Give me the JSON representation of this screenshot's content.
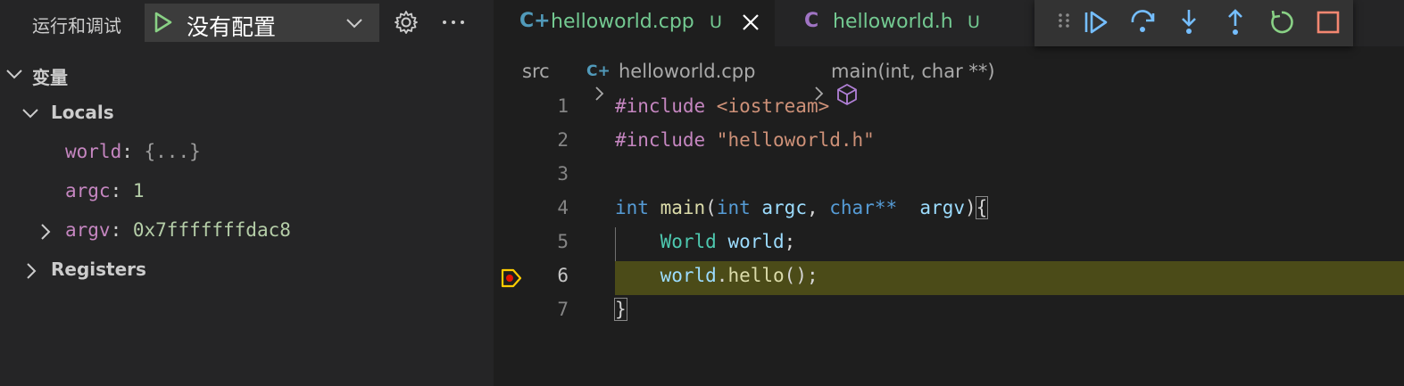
{
  "sidebar": {
    "title": "运行和调试",
    "launch_config": "没有配置",
    "variables_header": "变量",
    "locals_label": "Locals",
    "variables": [
      {
        "name": "world",
        "value": "{...}",
        "kind": "object",
        "expandable": false
      },
      {
        "name": "argc",
        "value": "1",
        "kind": "number",
        "expandable": false
      },
      {
        "name": "argv",
        "value": "0x7fffffffdac8",
        "kind": "number",
        "expandable": true
      }
    ],
    "registers_label": "Registers"
  },
  "tabs": [
    {
      "icon": "C+",
      "icon_color": "#519aba",
      "name": "helloworld.cpp",
      "status": "U",
      "active": true
    },
    {
      "icon": "C",
      "icon_color": "#a074c4",
      "name": "helloworld.h",
      "status": "U",
      "active": false
    }
  ],
  "debug_toolbar": [
    "drag-handle",
    "continue",
    "step-over",
    "step-into",
    "step-out",
    "restart",
    "stop"
  ],
  "breadcrumb": {
    "folder": "src",
    "file": "helloworld.cpp",
    "symbol": "main(int, char **)"
  },
  "code": {
    "current_line": 6,
    "line_numbers": [
      "1",
      "2",
      "3",
      "4",
      "5",
      "6",
      "7"
    ],
    "lines": {
      "l1_kw": "#include ",
      "l1_str": "<iostream>",
      "l2_kw": "#include ",
      "l2_str": "\"helloworld.h\"",
      "l4_int1": "int ",
      "l4_main": "main",
      "l4_paren": "(",
      "l4_int2": "int ",
      "l4_argc": "argc",
      "l4_comma": ", ",
      "l4_char": "char**",
      "l4_sp": "  ",
      "l4_argv": "argv",
      "l4_close": ")",
      "l4_brace": "{",
      "l5_indent": "    ",
      "l5_type": "World",
      "l5_sp": " ",
      "l5_var": "world",
      "l5_semi": ";",
      "l6_indent": "    ",
      "l6_var": "world",
      "l6_dot": ".",
      "l6_fn": "hello",
      "l6_rest": "();",
      "l7_brace": "}"
    }
  },
  "colors": {
    "accent_blue": "#75beff",
    "stop_red": "#f48771",
    "restart_green": "#89d185",
    "untracked_green": "#73c991",
    "breakpoint_yellow": "#ffcc00"
  }
}
